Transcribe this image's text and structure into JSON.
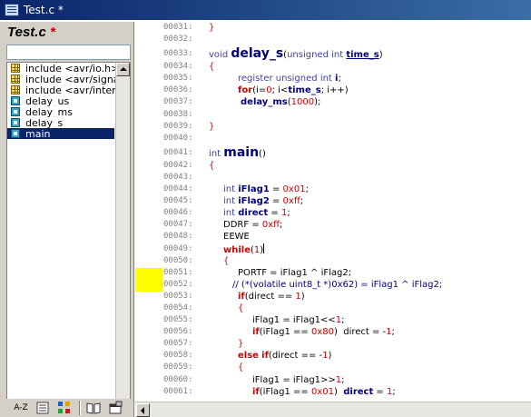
{
  "window": {
    "title": "Test.c *"
  },
  "panel": {
    "title": "Test.c",
    "modified_marker": "*",
    "filter_value": "",
    "items": [
      {
        "label": "include <avr/io.h>",
        "icon": "include-icon",
        "selected": false
      },
      {
        "label": "include <avr/signal.h>",
        "icon": "include-icon",
        "selected": false
      },
      {
        "label": "include <avr/interrupt.h>",
        "icon": "include-icon",
        "selected": false
      },
      {
        "label": "delay_us",
        "icon": "function-icon",
        "selected": false
      },
      {
        "label": "delay_ms",
        "icon": "function-icon",
        "selected": false
      },
      {
        "label": "delay_s",
        "icon": "function-icon",
        "selected": false
      },
      {
        "label": "main",
        "icon": "function-icon",
        "selected": true
      }
    ],
    "toolbar": {
      "sort_label": "A-Z",
      "buttons": [
        "sort-az-icon",
        "list-view-icon",
        "tree-view-icon",
        "book-icon",
        "properties-icon"
      ]
    }
  },
  "editor": {
    "highlight_lines": [
      "00051",
      "00052"
    ],
    "colors": {
      "keyword": "#d00000",
      "function": "#000080",
      "line_number": "#808080",
      "highlight": "#ffff00"
    },
    "lines": [
      {
        "n": "00031:",
        "code": "}"
      },
      {
        "n": "00032:",
        "code": ""
      },
      {
        "n": "00033:",
        "code": "void delay_s(unsigned int time_s)"
      },
      {
        "n": "00034:",
        "code": "{"
      },
      {
        "n": "00035:",
        "code": "register unsigned int i;"
      },
      {
        "n": "00036:",
        "code": "for(i=0; i<time_s; i++)"
      },
      {
        "n": "00037:",
        "code": "delay_ms(1000);"
      },
      {
        "n": "00038:",
        "code": ""
      },
      {
        "n": "00039:",
        "code": "}"
      },
      {
        "n": "00040:",
        "code": ""
      },
      {
        "n": "00041:",
        "code": "int main()"
      },
      {
        "n": "00042:",
        "code": "{"
      },
      {
        "n": "00043:",
        "code": ""
      },
      {
        "n": "00044:",
        "code": "int iFlag1 = 0x01;"
      },
      {
        "n": "00045:",
        "code": "int iFlag2 = 0xff;"
      },
      {
        "n": "00046:",
        "code": "int direct = 1;"
      },
      {
        "n": "00047:",
        "code": "DDRF = 0xff;"
      },
      {
        "n": "00048:",
        "code": "EEWE"
      },
      {
        "n": "00049:",
        "code": "while(1)"
      },
      {
        "n": "00050:",
        "code": "{"
      },
      {
        "n": "00051:",
        "code": "PORTF = iFlag1 ^ iFlag2;"
      },
      {
        "n": "00052:",
        "code": "// (*(volatile uint8_t *)0x62) = iFlag1 ^ iFlag2;"
      },
      {
        "n": "00053:",
        "code": "if(direct == 1)"
      },
      {
        "n": "00054:",
        "code": "{"
      },
      {
        "n": "00055:",
        "code": "iFlag1 = iFlag1<<1;"
      },
      {
        "n": "00056:",
        "code": "if(iFlag1 == 0x80)  direct = -1;"
      },
      {
        "n": "00057:",
        "code": "}"
      },
      {
        "n": "00058:",
        "code": "else if(direct == -1)"
      },
      {
        "n": "00059:",
        "code": "{"
      },
      {
        "n": "00060:",
        "code": "iFlag1 = iFlag1>>1;"
      },
      {
        "n": "00061:",
        "code": "if(iFlag1 == 0x01)  direct = 1;"
      }
    ]
  }
}
